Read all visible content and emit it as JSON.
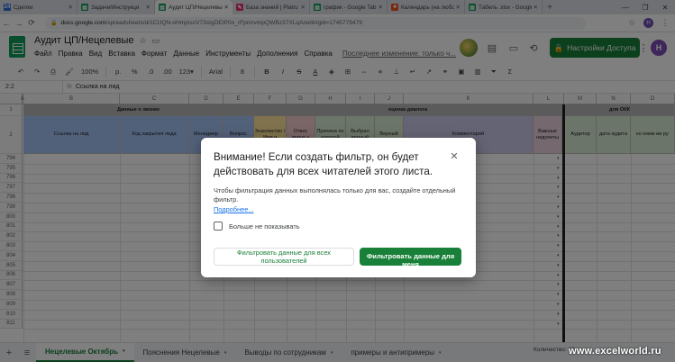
{
  "browser": {
    "tabs": [
      {
        "label": "Сделки",
        "icon": "deals-favicon",
        "color": "#2a6fdb",
        "glyph": "24"
      },
      {
        "label": "Задачи/Инструкци",
        "icon": "sheets-favicon",
        "color": "#0f9d58",
        "glyph": "▤"
      },
      {
        "label": "Аудит ЦП/Нецелевые",
        "icon": "sheets-favicon",
        "color": "#0f9d58",
        "glyph": "▤"
      },
      {
        "label": "База знаний | Platru",
        "icon": "platrum-favicon",
        "color": "#e8336d",
        "glyph": "✎"
      },
      {
        "label": "график - Google Tab",
        "icon": "sheets-favicon",
        "color": "#0f9d58",
        "glyph": "▤"
      },
      {
        "label": "Календарь (на любо",
        "icon": "microsoft-favicon",
        "color": "#f25022",
        "glyph": "■"
      },
      {
        "label": "Табель .xlsx - Google",
        "icon": "sheets-favicon",
        "color": "#0f9d58",
        "glyph": "▤"
      }
    ],
    "active_tab_index": 2,
    "new_tab_label": "+",
    "window_controls": {
      "minimize": "—",
      "maximize": "❐",
      "close": "✕"
    },
    "url_prefix": "docs.google.com",
    "url_rest": "/spreadsheets/d/1CUQN-oHmjnscV73sIgDEIP0n_rFpmrvmpQWBz37XLqA/edit#gid=1745779479",
    "profile_initial": "H"
  },
  "sheets": {
    "doc_title": "Аудит ЦП/Нецелевые",
    "menu": [
      "Файл",
      "Правка",
      "Вид",
      "Вставка",
      "Формат",
      "Данные",
      "Инструменты",
      "Дополнения",
      "Справка"
    ],
    "last_edit": "Последнее изменение: только ч...",
    "share_label": "Настройки Доступа",
    "user_initial": "H",
    "toolbar": {
      "zoom": "100%",
      "currency": "р.",
      "percent": "%",
      "dec0": ".0",
      "dec00": ".00",
      "format": "123▾",
      "font": "Arial",
      "bold": "B",
      "size": "8"
    }
  },
  "formula": {
    "cell_ref": "2:2",
    "value": "Ссылка на лид"
  },
  "grid": {
    "columns": [
      "A",
      "B",
      "C",
      "D",
      "E",
      "F",
      "G",
      "H",
      "I",
      "J",
      "K",
      "L",
      "M",
      "N",
      "O"
    ],
    "row1": {
      "left_header": "Данные о звонке",
      "mid_header": "оценка диалога",
      "right_header": "для ОКК"
    },
    "row2": [
      "Ссылка на лид",
      "Код закрытия лида",
      "Менеджер",
      "Вопрос",
      "Знакомство / Имя и",
      "Отвес верно к",
      "Причина по которой",
      "Выбрал верный",
      "Верный",
      "Комментарий",
      "Важные недочеты",
      "Аудитор",
      "дата аудита",
      "ко комм ии ру"
    ],
    "row_numbers": [
      "1",
      "2",
      "794",
      "795",
      "796",
      "797",
      "798",
      "799",
      "800",
      "801",
      "802",
      "803",
      "804",
      "805",
      "806",
      "807",
      "808",
      "809",
      "810",
      "811"
    ]
  },
  "sheet_tabs": {
    "add_icon": "+",
    "list_icon": "≡",
    "tabs": [
      "Нецелевые Октябрь",
      "Пояснения Нецелевые",
      "Выводы по сотрудникам",
      "примеры и антипримеры"
    ],
    "active_index": 0,
    "count_label": "Количество: 16"
  },
  "watermark": "www.excelworld.ru",
  "dialog": {
    "title": "Внимание! Если создать фильтр, он будет действовать для всех читателей этого листа.",
    "close_glyph": "✕",
    "body": "Чтобы фильтрация данных выполнялась только для вас, создайте отдельный фильтр.",
    "link": "Подробнее...",
    "checkbox_label": "Больше не показывать",
    "btn_all": "Фильтровать данные для всех пользователей",
    "btn_me": "Фильтровать данные для меня"
  }
}
